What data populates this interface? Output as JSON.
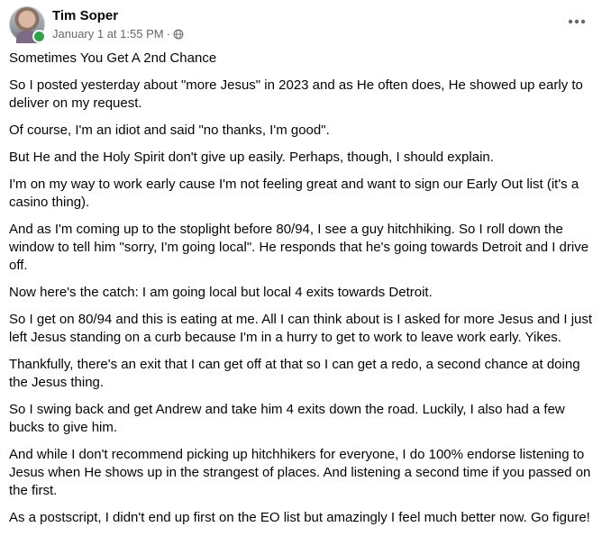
{
  "post": {
    "author": "Tim Soper",
    "timestamp": "January 1 at 1:55 PM",
    "separator": "·",
    "privacy_icon": "globe-icon",
    "more_icon": "more-options-icon",
    "online_color": "#31a24c",
    "paragraphs": [
      "Sometimes You Get A 2nd Chance",
      "So I posted yesterday about \"more Jesus\" in 2023 and as He often does, He showed up early to deliver on my request.",
      "Of course, I'm an idiot and said \"no thanks, I'm good\".",
      "But He and the Holy Spirit don't give up easily. Perhaps, though, I should explain.",
      "I'm on my way to work early cause I'm not feeling great and want to sign our Early Out list (it's a casino thing).",
      "And as I'm coming up to the stoplight before 80/94, I see a guy hitchhiking. So I roll down the window to tell him \"sorry, I'm going local\". He responds that he's going towards Detroit and I drive off.",
      "Now here's the catch: I am going local but local 4 exits towards Detroit.",
      "So I get on 80/94 and this is eating at me. All I can think about is I asked for more Jesus and I just left Jesus standing on a curb because I'm in a hurry to get to work to leave work early. Yikes.",
      "Thankfully, there's an exit that I can get off at that so I can get a redo, a second chance at doing the Jesus thing.",
      "So I swing back and get Andrew and take him 4 exits down the road. Luckily, I also had a few bucks to give him.",
      "And while I don't recommend picking up hitchhikers for everyone, I do 100% endorse listening to Jesus when He shows up in the strangest of places. And listening a second time if you passed on the first.",
      "As a postscript, I didn't end up first on the EO list but amazingly I feel much better now. Go figure!"
    ]
  }
}
